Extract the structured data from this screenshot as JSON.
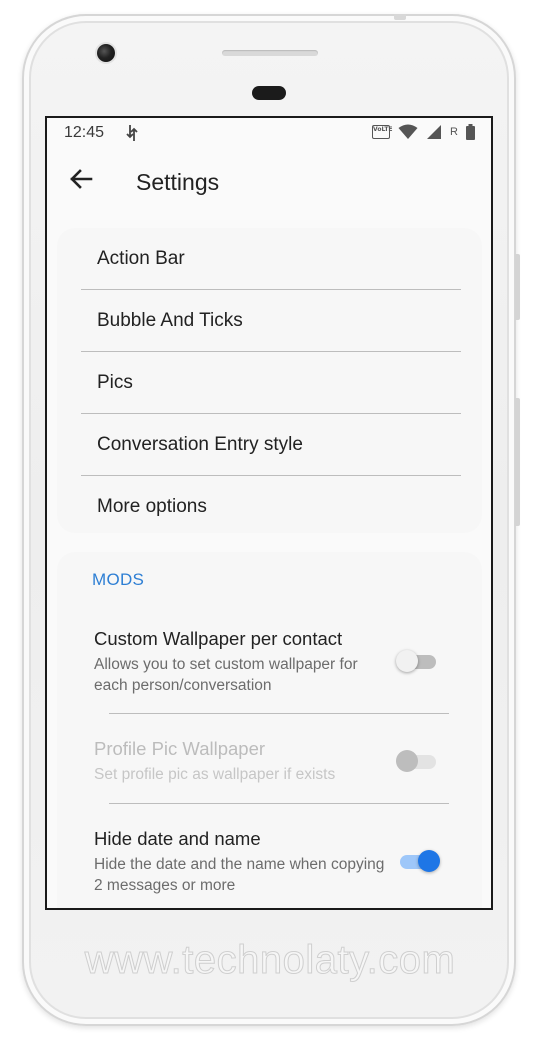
{
  "status_bar": {
    "time": "12:45",
    "volte_label": "VoLTE",
    "roaming_label": "R"
  },
  "app_bar": {
    "title": "Settings"
  },
  "menu": {
    "items": [
      {
        "label": "Action Bar"
      },
      {
        "label": "Bubble And Ticks"
      },
      {
        "label": "Pics"
      },
      {
        "label": "Conversation Entry style"
      },
      {
        "label": "More options"
      }
    ]
  },
  "mods": {
    "header": "MODS",
    "prefs": [
      {
        "title": "Custom Wallpaper per contact",
        "summary": "Allows you to set custom wallpaper for each person/conversation",
        "checked": false,
        "enabled": true
      },
      {
        "title": "Profile Pic Wallpaper",
        "summary": "Set profile pic as wallpaper if exists",
        "checked": false,
        "enabled": false
      },
      {
        "title": "Hide date and name",
        "summary": "Hide the date and the name when copying 2 messages or more",
        "checked": true,
        "enabled": true
      }
    ]
  },
  "watermark": "www.technolaty.com",
  "colors": {
    "accent": "#2e7fd4",
    "switch_on": "#1e76e6",
    "switch_on_track": "#9ec7f9"
  }
}
